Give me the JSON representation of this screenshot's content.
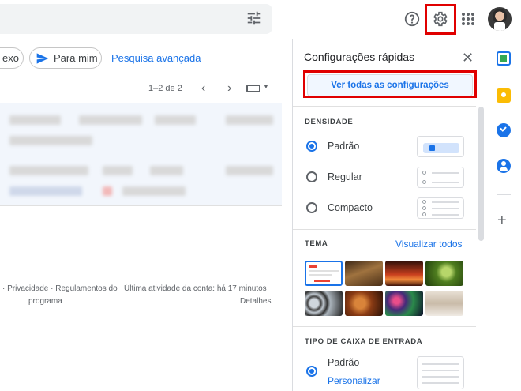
{
  "header": {
    "help_icon": "help-icon",
    "settings_icon": "gear-icon",
    "apps_icon": "apps-grid-icon",
    "search_options_icon": "tune-icon"
  },
  "filters": {
    "chip_attachment": "exo",
    "chip_to_me": "Para mim",
    "advanced_search": "Pesquisa avançada"
  },
  "toolbar": {
    "page_range": "1–2 de 2"
  },
  "footer": {
    "privacy": "· Privacidade · Regulamentos do",
    "program": "programa",
    "last_activity": "Última atividade da conta: há 17 minutos",
    "details": "Detalhes"
  },
  "quick_settings": {
    "title": "Configurações rápidas",
    "see_all": "Ver todas as configurações",
    "density": {
      "title": "DENSIDADE",
      "options": [
        "Padrão",
        "Regular",
        "Compacto"
      ],
      "selected": "Padrão"
    },
    "theme": {
      "title": "TEMA",
      "view_all": "Visualizar todos"
    },
    "inbox_type": {
      "title": "TIPO DE CAIXA DE ENTRADA",
      "option": "Padrão",
      "customize": "Personalizar"
    }
  },
  "colors": {
    "accent": "#1a73e8",
    "highlight": "#e00000"
  }
}
